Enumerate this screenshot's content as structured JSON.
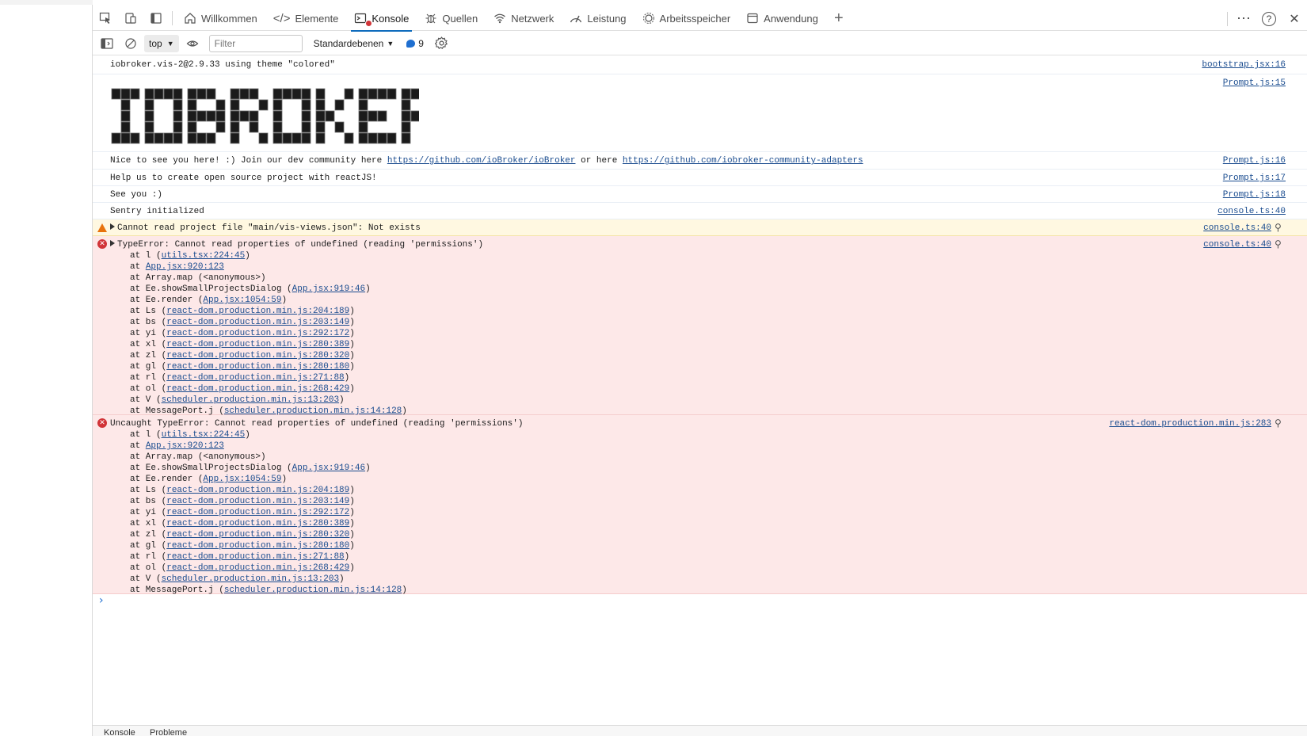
{
  "tabbar": {
    "tabs": [
      {
        "label": "Willkommen",
        "icon": "home-icon"
      },
      {
        "label": "Elemente",
        "icon": "code-icon"
      },
      {
        "label": "Konsole",
        "icon": "console-icon",
        "active": true
      },
      {
        "label": "Quellen",
        "icon": "bug-icon"
      },
      {
        "label": "Netzwerk",
        "icon": "wifi-icon"
      },
      {
        "label": "Leistung",
        "icon": "performance-icon"
      },
      {
        "label": "Arbeitsspeicher",
        "icon": "memory-icon"
      },
      {
        "label": "Anwendung",
        "icon": "application-icon"
      }
    ],
    "add_tab": "+",
    "more": "⋯",
    "help": "?",
    "close": "✕"
  },
  "toolbar": {
    "context": "top",
    "filter_placeholder": "Filter",
    "levels": "Standardebenen",
    "message_count": "9"
  },
  "console": {
    "rows": [
      {
        "type": "log",
        "text": "iobroker.vis-2@2.9.33 using theme \"colored\"",
        "source": "bootstrap.jsx:16"
      },
      {
        "type": "banner",
        "source": "Prompt.js:15",
        "banner_text": "IOBROKER"
      },
      {
        "type": "log",
        "text_pre": "Nice to see you here! :) Join our dev community here ",
        "link1": "https://github.com/ioBroker/ioBroker",
        "text_mid": " or here ",
        "link2": "https://github.com/iobroker-community-adapters",
        "source": "Prompt.js:16"
      },
      {
        "type": "log",
        "text": "Help us to create open source project with reactJS!",
        "source": "Prompt.js:17"
      },
      {
        "type": "log",
        "text": "See you :)",
        "source": "Prompt.js:18"
      },
      {
        "type": "log",
        "text": "Sentry initialized",
        "source": "console.ts:40"
      },
      {
        "type": "warn",
        "text": "Cannot read project file \"main/vis-views.json\": Not exists",
        "source": "console.ts:40"
      }
    ],
    "error1": {
      "title": "TypeError: Cannot read properties of undefined (reading 'permissions')",
      "source": "console.ts:40",
      "stack": [
        {
          "pre": "at l (",
          "link": "utils.tsx:224:45",
          "post": ")"
        },
        {
          "pre": "at ",
          "link": "App.jsx:920:123",
          "post": ""
        },
        {
          "pre": "at Array.map (<anonymous>)",
          "link": "",
          "post": ""
        },
        {
          "pre": "at Ee.showSmallProjectsDialog (",
          "link": "App.jsx:919:46",
          "post": ")"
        },
        {
          "pre": "at Ee.render (",
          "link": "App.jsx:1054:59",
          "post": ")"
        },
        {
          "pre": "at Ls (",
          "link": "react-dom.production.min.js:204:189",
          "post": ")"
        },
        {
          "pre": "at bs (",
          "link": "react-dom.production.min.js:203:149",
          "post": ")"
        },
        {
          "pre": "at yi (",
          "link": "react-dom.production.min.js:292:172",
          "post": ")"
        },
        {
          "pre": "at xl (",
          "link": "react-dom.production.min.js:280:389",
          "post": ")"
        },
        {
          "pre": "at zl (",
          "link": "react-dom.production.min.js:280:320",
          "post": ")"
        },
        {
          "pre": "at gl (",
          "link": "react-dom.production.min.js:280:180",
          "post": ")"
        },
        {
          "pre": "at rl (",
          "link": "react-dom.production.min.js:271:88",
          "post": ")"
        },
        {
          "pre": "at ol (",
          "link": "react-dom.production.min.js:268:429",
          "post": ")"
        },
        {
          "pre": "at V (",
          "link": "scheduler.production.min.js:13:203",
          "post": ")"
        },
        {
          "pre": "at MessagePort.j (",
          "link": "scheduler.production.min.js:14:128",
          "post": ")"
        }
      ]
    },
    "error2": {
      "title": "Uncaught TypeError: Cannot read properties of undefined (reading 'permissions')",
      "source": "react-dom.production.min.js:283",
      "stack": [
        {
          "pre": "at l (",
          "link": "utils.tsx:224:45",
          "post": ")"
        },
        {
          "pre": "at ",
          "link": "App.jsx:920:123",
          "post": ""
        },
        {
          "pre": "at Array.map (<anonymous>)",
          "link": "",
          "post": ""
        },
        {
          "pre": "at Ee.showSmallProjectsDialog (",
          "link": "App.jsx:919:46",
          "post": ")"
        },
        {
          "pre": "at Ee.render (",
          "link": "App.jsx:1054:59",
          "post": ")"
        },
        {
          "pre": "at Ls (",
          "link": "react-dom.production.min.js:204:189",
          "post": ")"
        },
        {
          "pre": "at bs (",
          "link": "react-dom.production.min.js:203:149",
          "post": ")"
        },
        {
          "pre": "at yi (",
          "link": "react-dom.production.min.js:292:172",
          "post": ")"
        },
        {
          "pre": "at xl (",
          "link": "react-dom.production.min.js:280:389",
          "post": ")"
        },
        {
          "pre": "at zl (",
          "link": "react-dom.production.min.js:280:320",
          "post": ")"
        },
        {
          "pre": "at gl (",
          "link": "react-dom.production.min.js:280:180",
          "post": ")"
        },
        {
          "pre": "at rl (",
          "link": "react-dom.production.min.js:271:88",
          "post": ")"
        },
        {
          "pre": "at ol (",
          "link": "react-dom.production.min.js:268:429",
          "post": ")"
        },
        {
          "pre": "at V (",
          "link": "scheduler.production.min.js:13:203",
          "post": ")"
        },
        {
          "pre": "at MessagePort.j (",
          "link": "scheduler.production.min.js:14:128",
          "post": ")"
        }
      ]
    },
    "prompt_symbol": "›"
  },
  "drawer": {
    "tab1": "Konsole",
    "tab2": "Probleme"
  },
  "colors": {
    "accent": "#0f6cbd",
    "error_bg": "#fde8e8",
    "warning_bg": "#fff8e1",
    "link": "#1a4c8f"
  }
}
